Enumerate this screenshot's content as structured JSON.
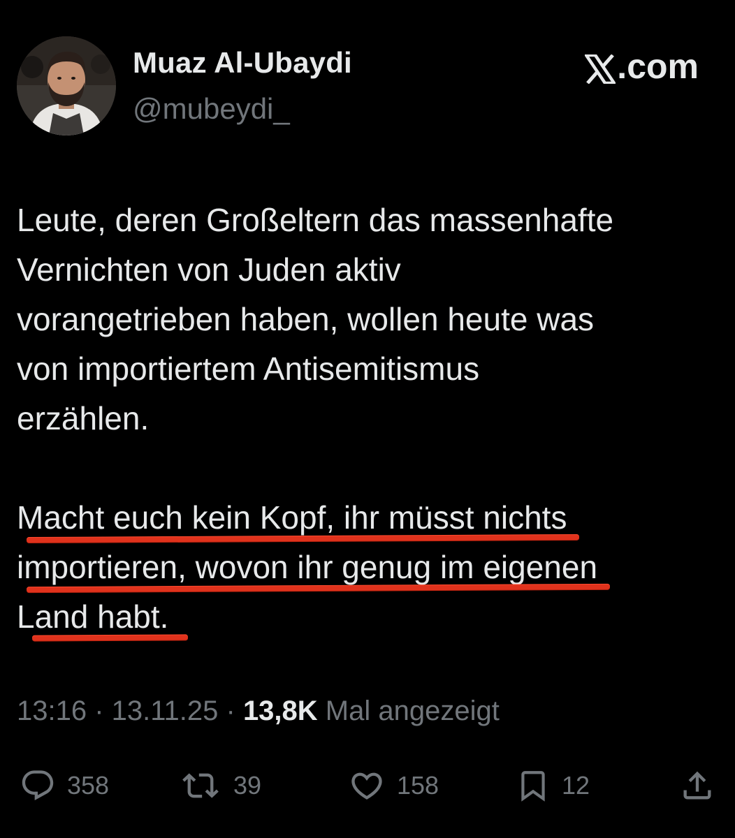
{
  "author": {
    "display_name": "Muaz Al-Ubaydi",
    "handle": "@mubeydi_",
    "avatar_icon": "profile-photo"
  },
  "brand": {
    "logo_icon": "x-logo-icon",
    "domain_text": ".com"
  },
  "tweet": {
    "paragraph1": [
      "Leute, deren Großeltern das massenhafte",
      "Vernichten von Juden aktiv",
      "vorangetrieben haben, wollen  heute was",
      "von importiertem Antisemitismus",
      "erzählen."
    ],
    "paragraph2": [
      "Macht euch kein Kopf, ihr müsst nichts",
      "importieren, wovon ihr genug im eigenen",
      "Land habt."
    ],
    "highlight_color": "#e0321c"
  },
  "meta": {
    "time": "13:16",
    "separator": " · ",
    "date": "13.11.25",
    "views_count": "13,8K",
    "views_label": " Mal angezeigt"
  },
  "actions": {
    "replies": {
      "icon": "reply-icon",
      "count": "358"
    },
    "reposts": {
      "icon": "repost-icon",
      "count": "39"
    },
    "likes": {
      "icon": "heart-icon",
      "count": "158"
    },
    "bookmarks": {
      "icon": "bookmark-icon",
      "count": "12"
    },
    "share": {
      "icon": "share-icon"
    }
  },
  "colors": {
    "background": "#000000",
    "text_primary": "#e7e9ea",
    "text_secondary": "#71767b"
  }
}
